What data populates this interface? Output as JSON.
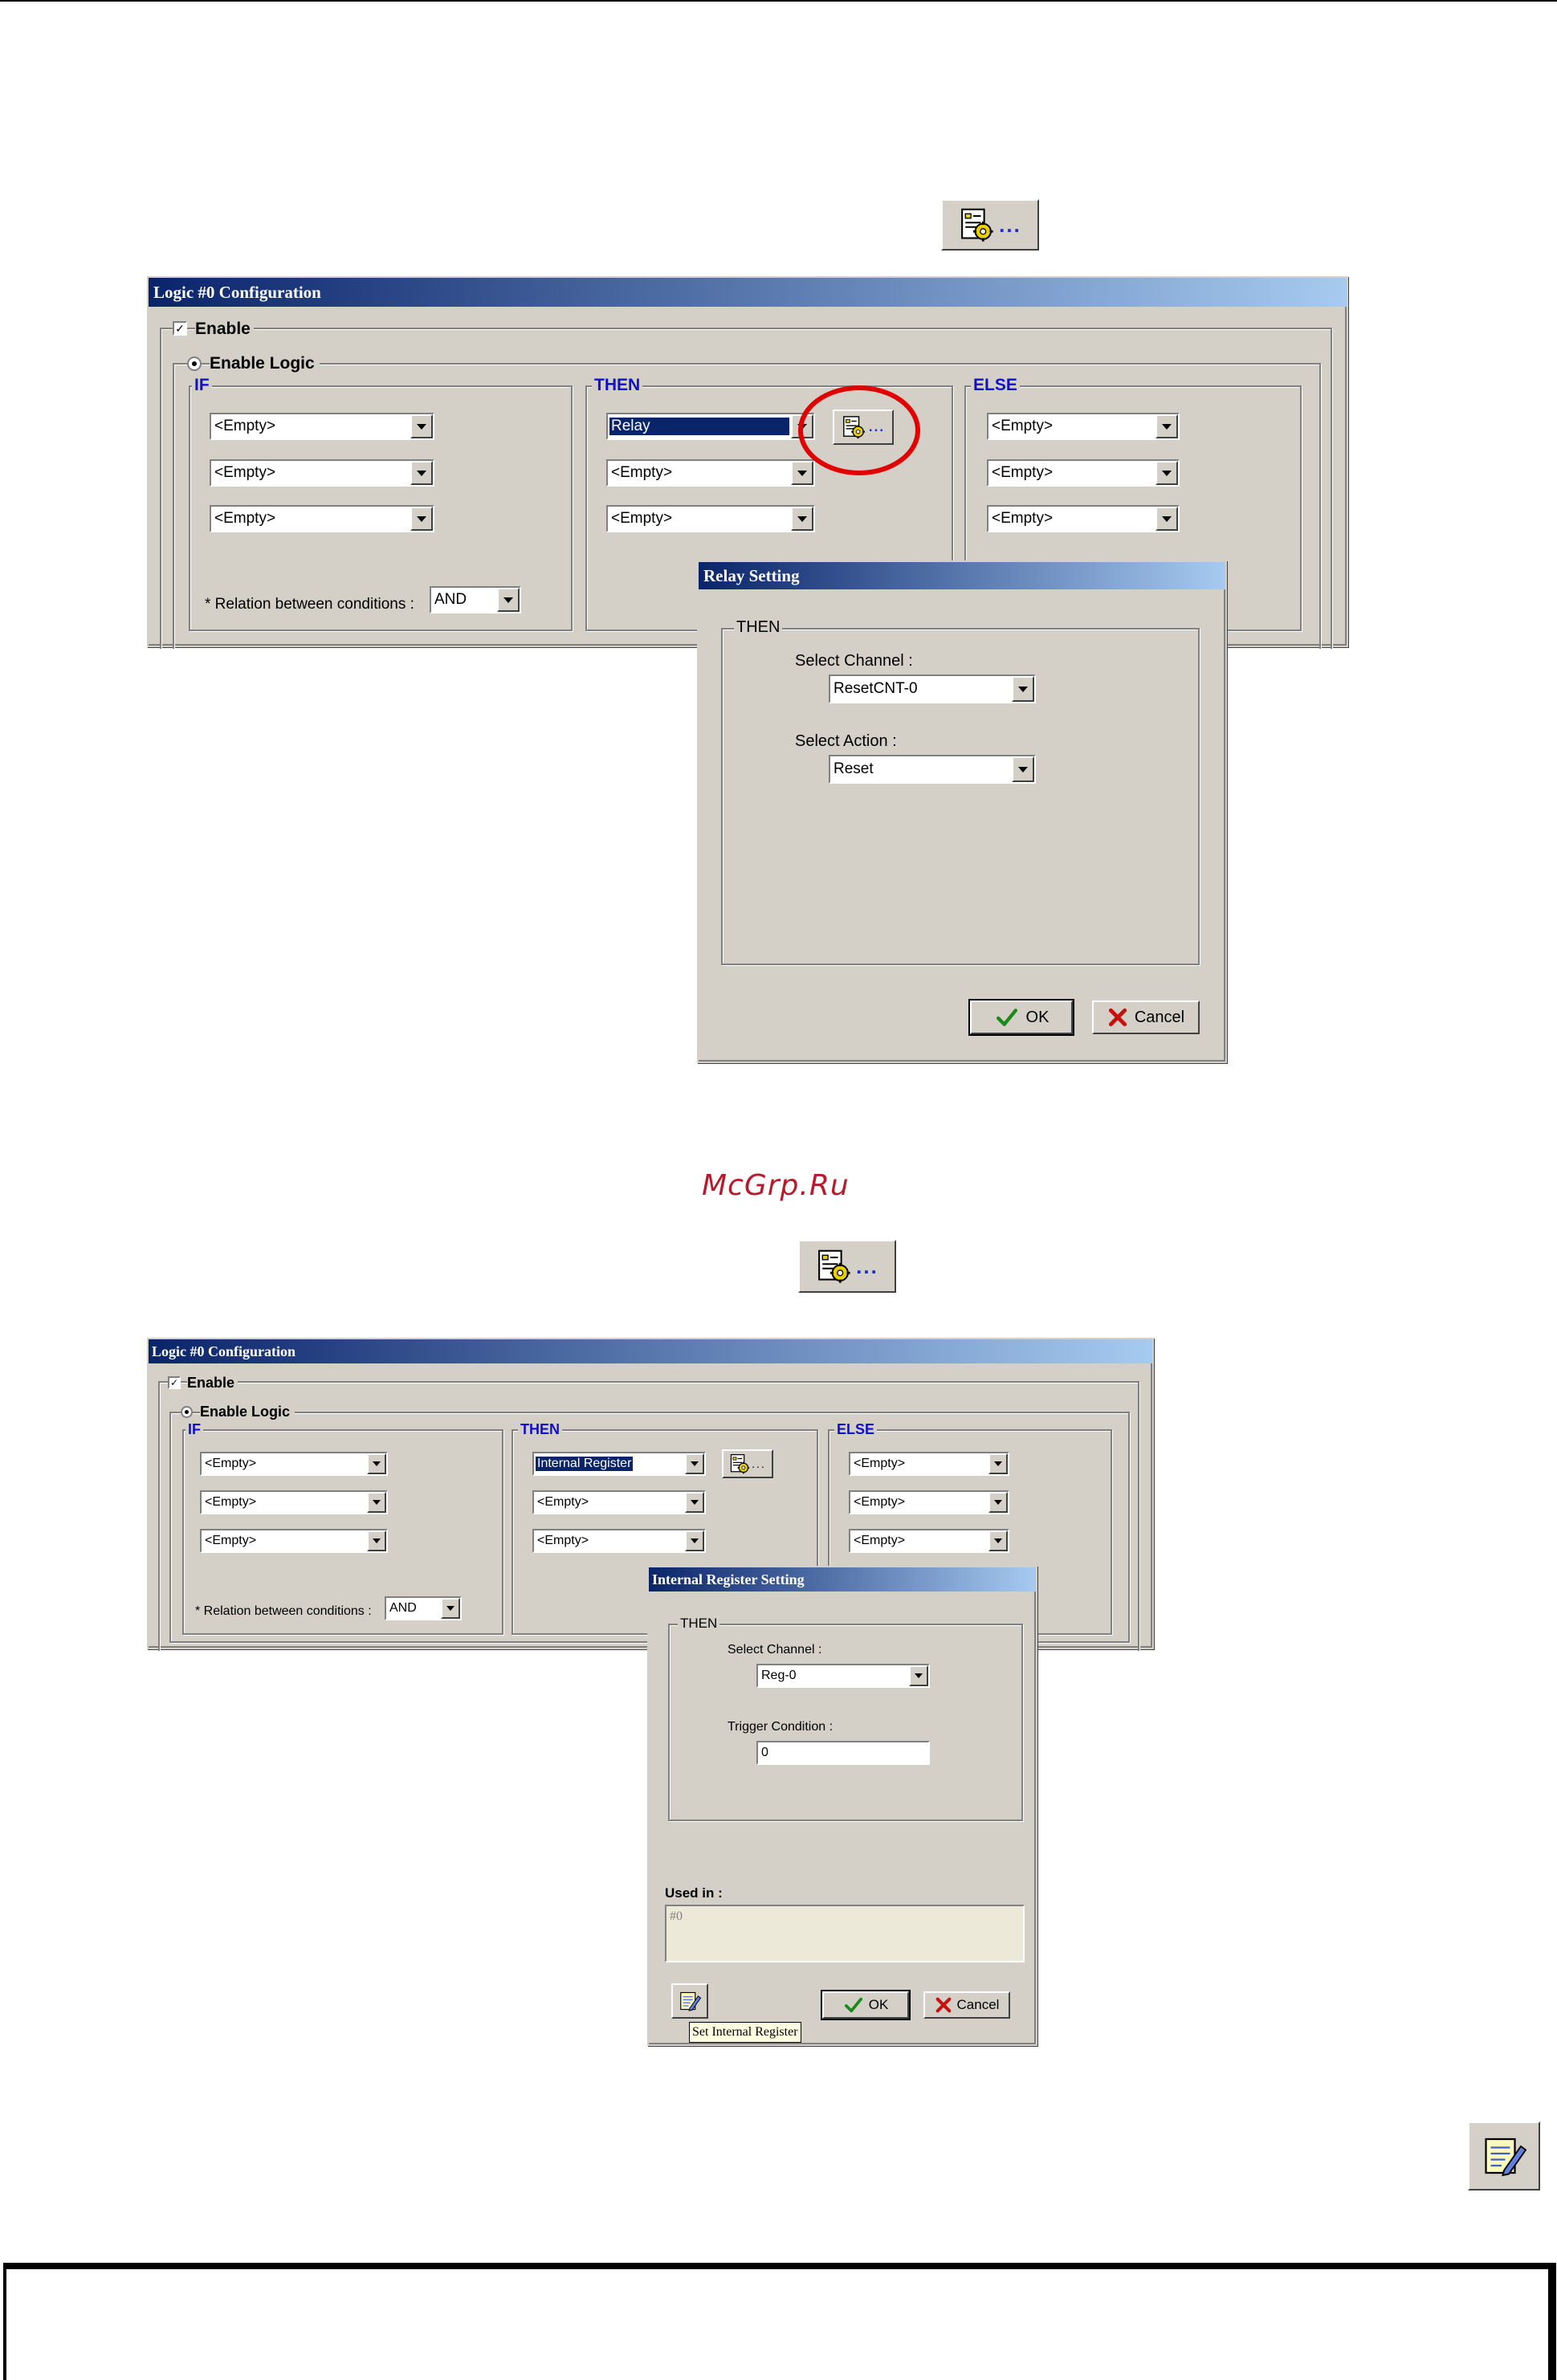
{
  "watermark": "McGrp.Ru",
  "icons": {
    "settings_dots": "...",
    "settings_icon": "document-settings-icon",
    "edit_icon": "notepad-pencil-icon"
  },
  "window1": {
    "title": "Logic #0 Configuration",
    "enable_label": "Enable",
    "enable_checked": true,
    "enable_logic_label": "Enable Logic",
    "if": {
      "label": "IF",
      "items": [
        "<Empty>",
        "<Empty>",
        "<Empty>"
      ],
      "relation_label": "* Relation between conditions :",
      "relation_value": "AND"
    },
    "then": {
      "label": "THEN",
      "items": [
        "Relay",
        "<Empty>",
        "<Empty>"
      ],
      "settings_dots": "..."
    },
    "else": {
      "label": "ELSE",
      "items": [
        "<Empty>",
        "<Empty>",
        "<Empty>"
      ]
    }
  },
  "relay_dialog": {
    "title": "Relay Setting",
    "group_label": "THEN",
    "channel_label": "Select Channel :",
    "channel_value": "ResetCNT-0",
    "action_label": "Select Action :",
    "action_value": "Reset",
    "ok_label": "OK",
    "cancel_label": "Cancel"
  },
  "window2": {
    "title": "Logic #0 Configuration",
    "enable_label": "Enable",
    "enable_checked": true,
    "enable_logic_label": "Enable Logic",
    "if": {
      "label": "IF",
      "items": [
        "<Empty>",
        "<Empty>",
        "<Empty>"
      ],
      "relation_label": "* Relation between conditions :",
      "relation_value": "AND"
    },
    "then": {
      "label": "THEN",
      "items": [
        "Internal Register",
        "<Empty>",
        "<Empty>"
      ],
      "settings_dots": "..."
    },
    "else": {
      "label": "ELSE",
      "items": [
        "<Empty>",
        "<Empty>",
        "<Empty>"
      ]
    }
  },
  "register_dialog": {
    "title": "Internal Register Setting",
    "group_label": "THEN",
    "channel_label": "Select Channel :",
    "channel_value": "Reg-0",
    "trigger_label": "Trigger Condition :",
    "trigger_value": "0",
    "used_in_label": "Used in :",
    "used_in_value": "#0",
    "ok_label": "OK",
    "cancel_label": "Cancel",
    "tooltip": "Set Internal Register"
  },
  "colors": {
    "window_bg": "#d4d0c8",
    "title_gradient_start": "#0a246a",
    "title_gradient_end": "#a6caf0",
    "group_label_blue": "#1010c8",
    "highlight_circle": "#e00000",
    "watermark": "#b81a2c"
  }
}
